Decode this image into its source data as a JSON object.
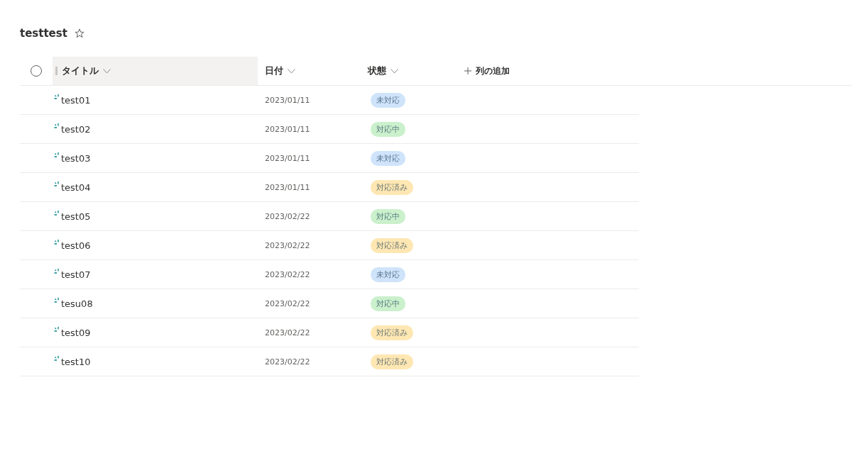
{
  "list_title": "testtest",
  "columns": [
    {
      "label": "タイトル",
      "selected": true
    },
    {
      "label": "日付",
      "selected": false
    },
    {
      "label": "状態",
      "selected": false
    }
  ],
  "add_column": "列の追加",
  "select_all": {
    "checked": false
  },
  "rows": [
    {
      "title": "test01",
      "date": "2023/01/11",
      "status": "未対応",
      "color": "#cfe4fa"
    },
    {
      "title": "test02",
      "date": "2023/01/11",
      "status": "対応中",
      "color": "#caf0cc"
    },
    {
      "title": "test03",
      "date": "2023/01/11",
      "status": "未対応",
      "color": "#cfe4fa"
    },
    {
      "title": "test04",
      "date": "2023/01/11",
      "status": "対応済み",
      "color": "#fee7b2"
    },
    {
      "title": "test05",
      "date": "2023/02/22",
      "status": "対応中",
      "color": "#caf0cc"
    },
    {
      "title": "test06",
      "date": "2023/02/22",
      "status": "対応済み",
      "color": "#fee7b2"
    },
    {
      "title": "test07",
      "date": "2023/02/22",
      "status": "未対応",
      "color": "#cfe4fa"
    },
    {
      "title": "tesu08",
      "date": "2023/02/22",
      "status": "対応中",
      "color": "#caf0cc"
    },
    {
      "title": "test09",
      "date": "2023/02/22",
      "status": "対応済み",
      "color": "#fee7b2"
    },
    {
      "title": "test10",
      "date": "2023/02/22",
      "status": "対応済み",
      "color": "#fee7b2"
    }
  ]
}
